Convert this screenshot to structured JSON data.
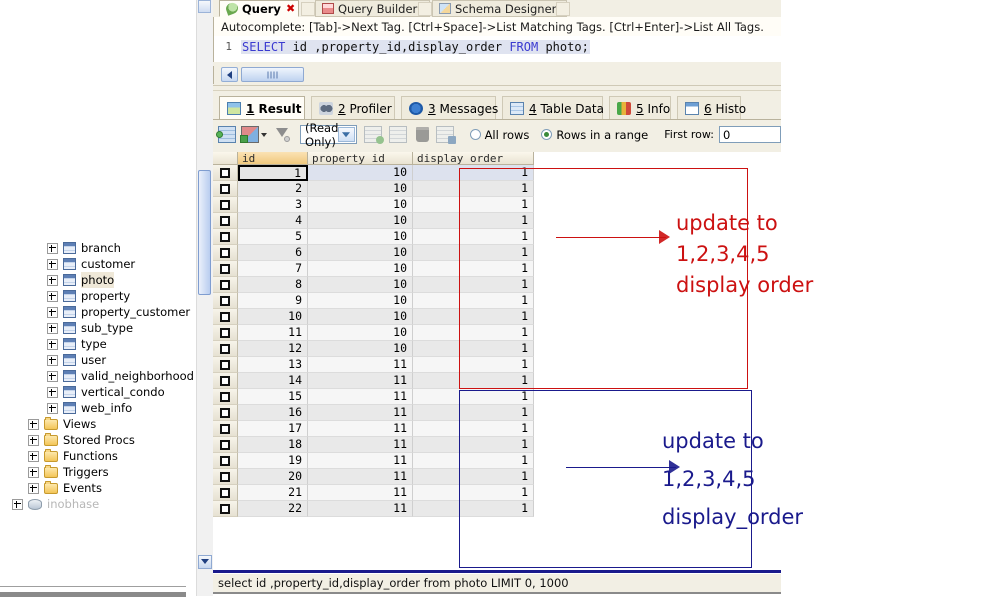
{
  "editor_tabs": [
    {
      "label": "Query",
      "icon": "query-icon",
      "active": true,
      "closable": true
    },
    {
      "label": "Query Builder",
      "icon": "query-builder-icon",
      "active": false,
      "closable": false
    },
    {
      "label": "Schema Designer",
      "icon": "schema-designer-icon",
      "active": false,
      "closable": false
    }
  ],
  "hint_bar": {
    "text": "Autocomplete: [Tab]->Next Tag. [Ctrl+Space]->List Matching Tags. [Ctrl+Enter]->List All Tags."
  },
  "editor": {
    "line_number": "1",
    "sql_parts": [
      {
        "text": "SELECT",
        "type": "keyword"
      },
      {
        "text": " id ,property_id,display_order ",
        "type": "plain"
      },
      {
        "text": "FROM",
        "type": "keyword"
      },
      {
        "text": " photo;",
        "type": "plain"
      }
    ],
    "sql_full": "SELECT id ,property_id,display_order FROM photo;"
  },
  "result_tabs": [
    {
      "num": "1",
      "label": "Result",
      "icon": "result-grid-icon",
      "active": true
    },
    {
      "num": "2",
      "label": "Profiler",
      "icon": "profiler-icon",
      "active": false
    },
    {
      "num": "3",
      "label": "Messages",
      "icon": "messages-icon",
      "active": false
    },
    {
      "num": "4",
      "label": "Table Data",
      "icon": "table-data-icon",
      "active": false
    },
    {
      "num": "5",
      "label": "Info",
      "icon": "info-chart-icon",
      "active": false
    },
    {
      "num": "6",
      "label": "Histo",
      "icon": "history-calendar-icon",
      "active": false
    }
  ],
  "grid_toolbar": {
    "mode_value": "(Read Only)",
    "all_rows_label": "All rows",
    "rows_in_range_label": "Rows in a range",
    "first_row_label": "First row:",
    "first_row_value": "0",
    "all_rows_selected": false,
    "rows_in_range_selected": true
  },
  "grid": {
    "columns": [
      "id",
      "property_id",
      "display_order"
    ],
    "sorted_column": "id",
    "rows": [
      {
        "id": "1",
        "property_id": "10",
        "display_order": "1"
      },
      {
        "id": "2",
        "property_id": "10",
        "display_order": "1"
      },
      {
        "id": "3",
        "property_id": "10",
        "display_order": "1"
      },
      {
        "id": "4",
        "property_id": "10",
        "display_order": "1"
      },
      {
        "id": "5",
        "property_id": "10",
        "display_order": "1"
      },
      {
        "id": "6",
        "property_id": "10",
        "display_order": "1"
      },
      {
        "id": "7",
        "property_id": "10",
        "display_order": "1"
      },
      {
        "id": "8",
        "property_id": "10",
        "display_order": "1"
      },
      {
        "id": "9",
        "property_id": "10",
        "display_order": "1"
      },
      {
        "id": "10",
        "property_id": "10",
        "display_order": "1"
      },
      {
        "id": "11",
        "property_id": "10",
        "display_order": "1"
      },
      {
        "id": "12",
        "property_id": "10",
        "display_order": "1"
      },
      {
        "id": "13",
        "property_id": "11",
        "display_order": "1"
      },
      {
        "id": "14",
        "property_id": "11",
        "display_order": "1"
      },
      {
        "id": "15",
        "property_id": "11",
        "display_order": "1"
      },
      {
        "id": "16",
        "property_id": "11",
        "display_order": "1"
      },
      {
        "id": "17",
        "property_id": "11",
        "display_order": "1"
      },
      {
        "id": "18",
        "property_id": "11",
        "display_order": "1"
      },
      {
        "id": "19",
        "property_id": "11",
        "display_order": "1"
      },
      {
        "id": "20",
        "property_id": "11",
        "display_order": "1"
      },
      {
        "id": "21",
        "property_id": "11",
        "display_order": "1"
      },
      {
        "id": "22",
        "property_id": "11",
        "display_order": "1"
      }
    ]
  },
  "status_bar": {
    "text": "select id ,property_id,display_order from photo LIMIT 0, 1000"
  },
  "tree": {
    "tables": [
      {
        "label": "branch",
        "icon": "table-icon",
        "selected": false
      },
      {
        "label": "customer",
        "icon": "table-icon",
        "selected": false
      },
      {
        "label": "photo",
        "icon": "table-icon",
        "selected": true
      },
      {
        "label": "property",
        "icon": "table-icon",
        "selected": false
      },
      {
        "label": "property_customer",
        "icon": "table-icon",
        "selected": false
      },
      {
        "label": "sub_type",
        "icon": "table-icon",
        "selected": false
      },
      {
        "label": "type",
        "icon": "table-icon",
        "selected": false
      },
      {
        "label": "user",
        "icon": "table-icon",
        "selected": false
      },
      {
        "label": "valid_neighborhood",
        "icon": "table-icon",
        "selected": false
      },
      {
        "label": "vertical_condo",
        "icon": "table-icon",
        "selected": false
      },
      {
        "label": "web_info",
        "icon": "table-icon",
        "selected": false
      }
    ],
    "folders": [
      {
        "label": "Views",
        "icon": "folder-icon"
      },
      {
        "label": "Stored Procs",
        "icon": "folder-icon"
      },
      {
        "label": "Functions",
        "icon": "folder-icon"
      },
      {
        "label": "Triggers",
        "icon": "folder-icon"
      },
      {
        "label": "Events",
        "icon": "folder-icon"
      }
    ],
    "database_item": {
      "label": "inobhase",
      "icon": "database-icon"
    }
  },
  "annotations": {
    "red": {
      "line1": "update to",
      "line2": "1,2,3,4,5",
      "line3": "display order",
      "color": "#cc1111"
    },
    "blue": {
      "line1": "update to",
      "line2": "1,2,3,4,5",
      "line3": "display_order",
      "color": "#1a1a8c"
    }
  }
}
